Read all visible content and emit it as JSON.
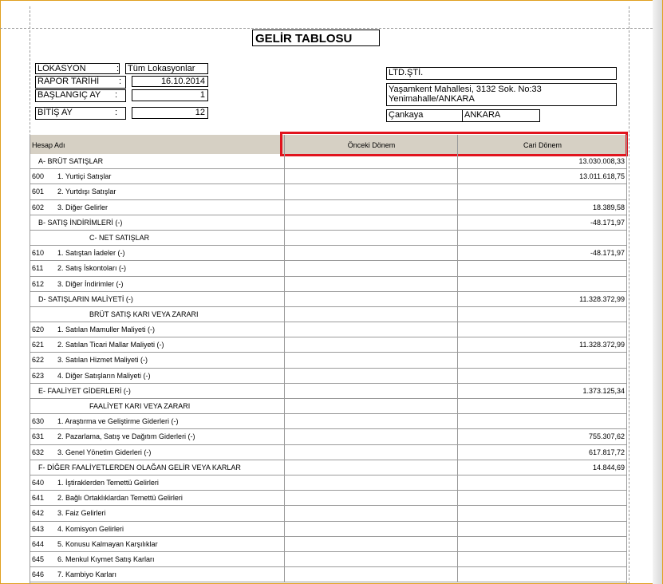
{
  "report": {
    "title": "GELİR TABLOSU",
    "fields": {
      "lokasyon_label": "LOKASYON",
      "lokasyon_value": "Tüm Lokasyonlar",
      "rapor_tarihi_label": "RAPOR TARİHİ",
      "rapor_tarihi_value": "16.10.2014",
      "baslangic_label": "BAŞLANGIÇ AY",
      "baslangic_value": "1",
      "bitis_label": "BİTİŞ AY",
      "bitis_value": "12",
      "colon": ":"
    },
    "company": {
      "name": "LTD.ŞTİ.",
      "address": "Yaşamkent Mahallesi, 3132 Sok. No:33 Yenimahalle/ANKARA",
      "tax_office_label": "Çankaya",
      "tax_office_value": "ANKARA"
    }
  },
  "table": {
    "headers": {
      "account": "Hesap Adı",
      "previous": "Önceki Dönem",
      "current": "Cari Dönem"
    },
    "rows": [
      {
        "code": "",
        "name": "A- BRÜT SATIŞLAR",
        "style": "section",
        "previous": "",
        "current": "13.030.008,33"
      },
      {
        "code": "600",
        "name": "1. Yurtiçi Satışlar",
        "style": "item",
        "previous": "",
        "current": "13.011.618,75"
      },
      {
        "code": "601",
        "name": "2. Yurtdışı Satışlar",
        "style": "item",
        "previous": "",
        "current": ""
      },
      {
        "code": "602",
        "name": "3. Diğer Gelirler",
        "style": "item",
        "previous": "",
        "current": "18.389,58"
      },
      {
        "code": "",
        "name": "B- SATIŞ İNDİRİMLERİ (-)",
        "style": "section",
        "previous": "",
        "current": "-48.171,97"
      },
      {
        "code": "",
        "name": "C- NET SATIŞLAR",
        "style": "center",
        "previous": "",
        "current": ""
      },
      {
        "code": "610",
        "name": "1. Satıştan İadeler (-)",
        "style": "item",
        "previous": "",
        "current": "-48.171,97"
      },
      {
        "code": "611",
        "name": "2. Satış İskontoları (-)",
        "style": "item",
        "previous": "",
        "current": ""
      },
      {
        "code": "612",
        "name": "3. Diğer İndirimler (-)",
        "style": "item",
        "previous": "",
        "current": ""
      },
      {
        "code": "",
        "name": "D- SATIŞLARIN MALİYETİ (-)",
        "style": "section",
        "previous": "",
        "current": "11.328.372,99"
      },
      {
        "code": "",
        "name": "BRÜT SATIŞ KARI VEYA ZARARI",
        "style": "center",
        "previous": "",
        "current": ""
      },
      {
        "code": "620",
        "name": "1. Satılan Mamuller Maliyeti (-)",
        "style": "item",
        "previous": "",
        "current": ""
      },
      {
        "code": "621",
        "name": "2. Satılan Ticari Mallar Maliyeti (-)",
        "style": "item",
        "previous": "",
        "current": "11.328.372,99"
      },
      {
        "code": "622",
        "name": "3. Satılan Hizmet Maliyeti (-)",
        "style": "item",
        "previous": "",
        "current": ""
      },
      {
        "code": "623",
        "name": "4. Diğer Satışların Maliyeti (-)",
        "style": "item",
        "previous": "",
        "current": ""
      },
      {
        "code": "",
        "name": "E- FAALİYET GİDERLERİ (-)",
        "style": "section",
        "previous": "",
        "current": "1.373.125,34"
      },
      {
        "code": "",
        "name": "FAALİYET KARI VEYA ZARARI",
        "style": "center",
        "previous": "",
        "current": ""
      },
      {
        "code": "630",
        "name": "1. Araştırma ve Geliştirme Giderleri (-)",
        "style": "item",
        "previous": "",
        "current": ""
      },
      {
        "code": "631",
        "name": "2. Pazarlama, Satış ve Dağıtım Giderleri (-)",
        "style": "item",
        "previous": "",
        "current": "755.307,62"
      },
      {
        "code": "632",
        "name": "3. Genel Yönetim Giderleri (-)",
        "style": "item",
        "previous": "",
        "current": "617.817,72"
      },
      {
        "code": "",
        "name": "F- DİĞER FAALİYETLERDEN OLAĞAN GELİR VEYA KARLAR",
        "style": "section",
        "previous": "",
        "current": "14.844,69"
      },
      {
        "code": "640",
        "name": "1. İştiraklerden Temettü Gelirleri",
        "style": "item",
        "previous": "",
        "current": ""
      },
      {
        "code": "641",
        "name": "2. Bağlı Ortaklıklardan Temettü Gelirleri",
        "style": "item",
        "previous": "",
        "current": ""
      },
      {
        "code": "642",
        "name": "3. Faiz Gelirleri",
        "style": "item",
        "previous": "",
        "current": ""
      },
      {
        "code": "643",
        "name": "4. Komisyon Gelirleri",
        "style": "item",
        "previous": "",
        "current": ""
      },
      {
        "code": "644",
        "name": "5. Konusu Kalmayan Karşılıklar",
        "style": "item",
        "previous": "",
        "current": ""
      },
      {
        "code": "645",
        "name": "6. Menkul Kıymet Satış Karları",
        "style": "item",
        "previous": "",
        "current": ""
      },
      {
        "code": "646",
        "name": "7. Kambiyo Karları",
        "style": "item",
        "previous": "",
        "current": ""
      }
    ]
  },
  "colors": {
    "header_bg": "#d6d0c4",
    "highlight": "#e1141e",
    "frame": "#e0a020"
  }
}
